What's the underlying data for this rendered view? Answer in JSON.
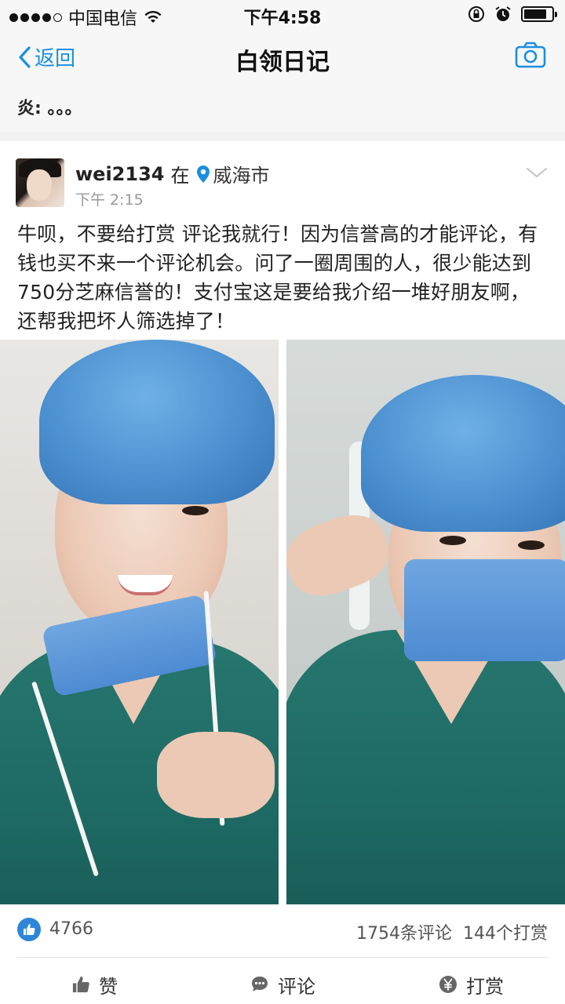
{
  "status_bar": {
    "carrier": "中国电信",
    "time": "下午4:58"
  },
  "nav": {
    "back_label": "返回",
    "title": "白领日记"
  },
  "prev_comment": {
    "text": "炎: 。。。"
  },
  "post": {
    "username": "wei2134",
    "at_label": "在",
    "location": "威海市",
    "time": "下午 2:15",
    "text": "牛呗，不要给打赏 评论我就行！因为信誉高的才能评论，有钱也买不来一个评论机会。问了一圈周围的人，很少能达到750分芝麻信誉的！支付宝这是要给我介绍一堆好朋友啊，还帮我把坏人筛选掉了！",
    "likes": "4766",
    "comments": "1754条评论",
    "tips": "144个打赏"
  },
  "actions": {
    "like_label": "赞",
    "comment_label": "评论",
    "tip_label": "打赏"
  },
  "colors": {
    "accent": "#1a8fe0",
    "like_badge": "#2f86d9",
    "scrubs": "#1e6a64",
    "cap": "#4b90d0"
  }
}
